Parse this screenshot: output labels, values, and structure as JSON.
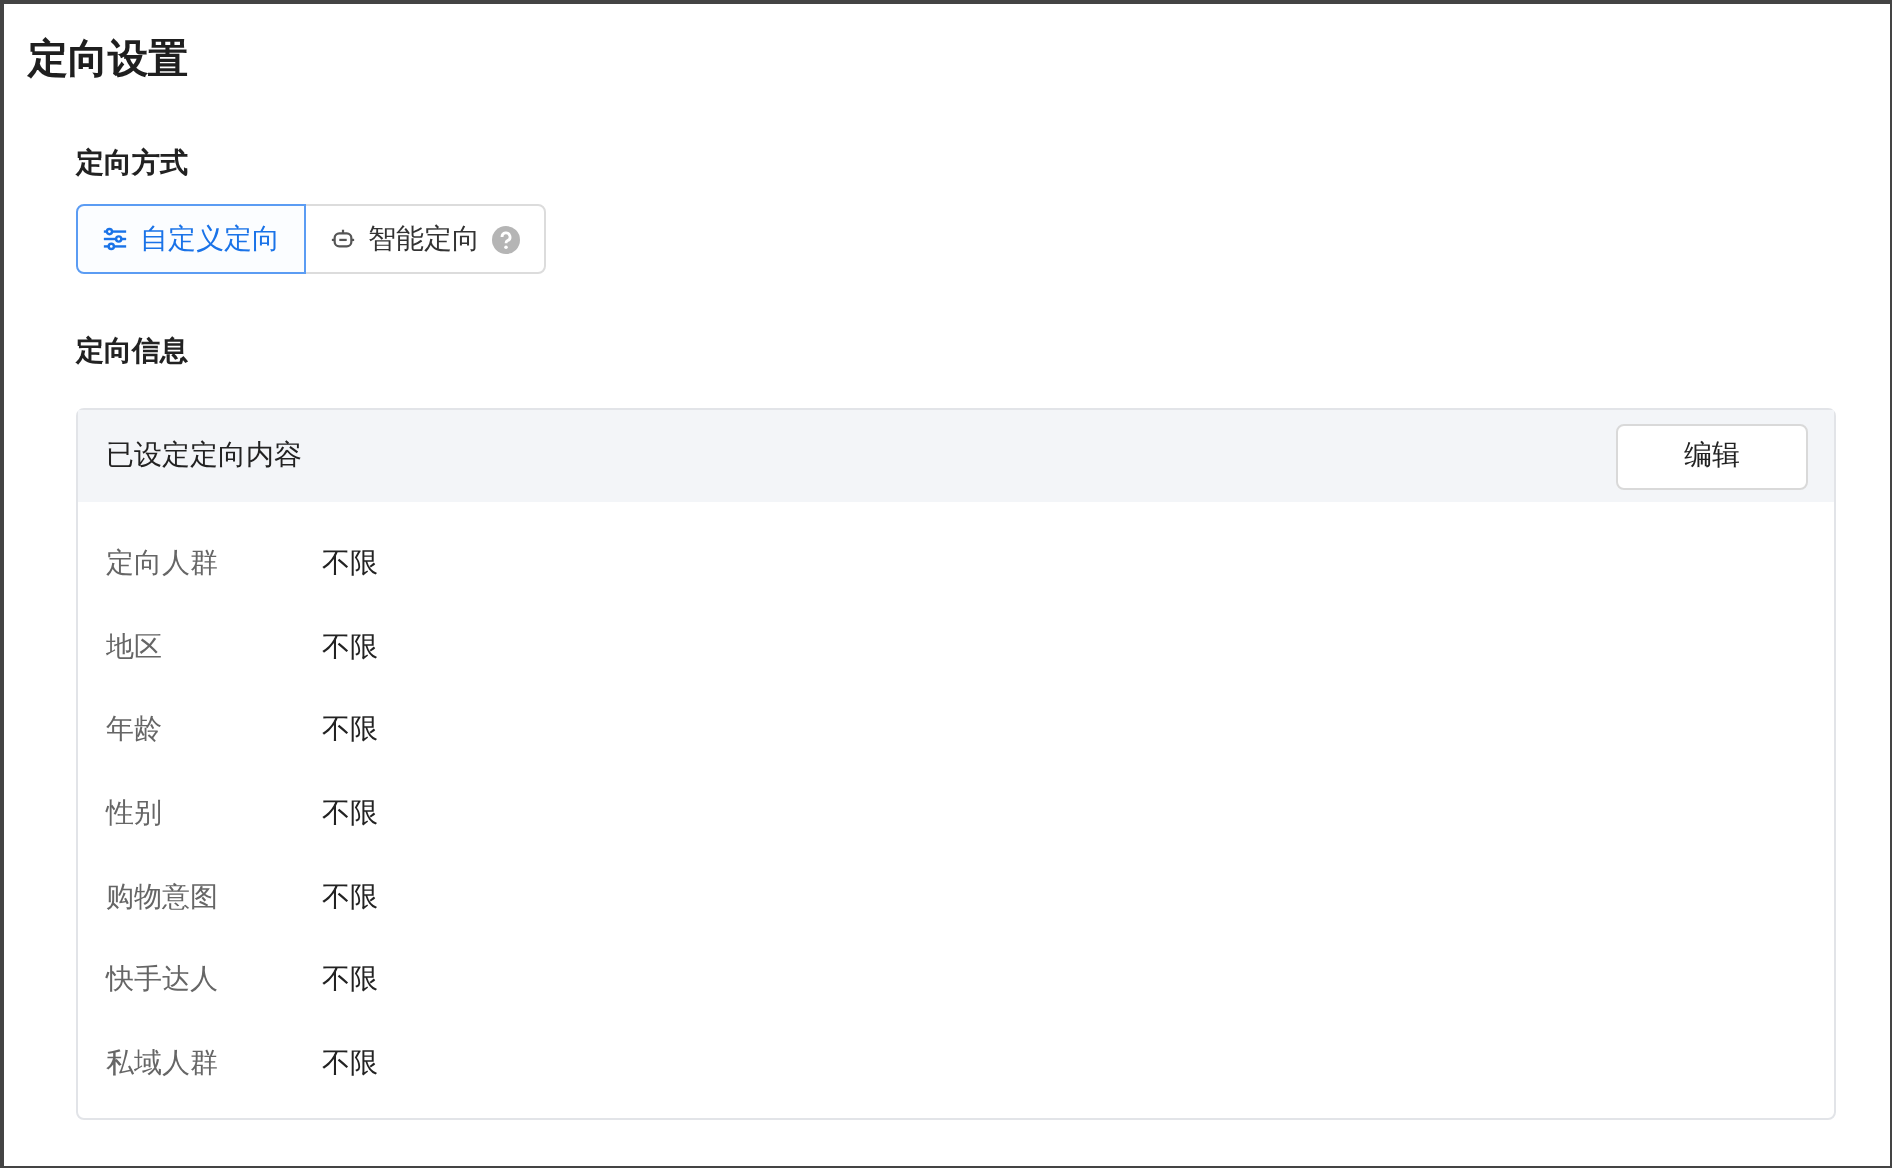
{
  "title": "定向设置",
  "mode": {
    "label": "定向方式",
    "options": [
      {
        "label": "自定义定向",
        "kind": "custom",
        "selected": true,
        "help": false
      },
      {
        "label": "智能定向",
        "kind": "smart",
        "selected": false,
        "help": true
      }
    ]
  },
  "info": {
    "label": "定向信息",
    "panel_title": "已设定定向内容",
    "edit_button": "编辑",
    "rows": [
      {
        "name": "定向人群",
        "value": "不限"
      },
      {
        "name": "地区",
        "value": "不限"
      },
      {
        "name": "年龄",
        "value": "不限"
      },
      {
        "name": "性别",
        "value": "不限"
      },
      {
        "name": "购物意图",
        "value": "不限"
      },
      {
        "name": "快手达人",
        "value": "不限"
      },
      {
        "name": "私域人群",
        "value": "不限"
      }
    ]
  }
}
